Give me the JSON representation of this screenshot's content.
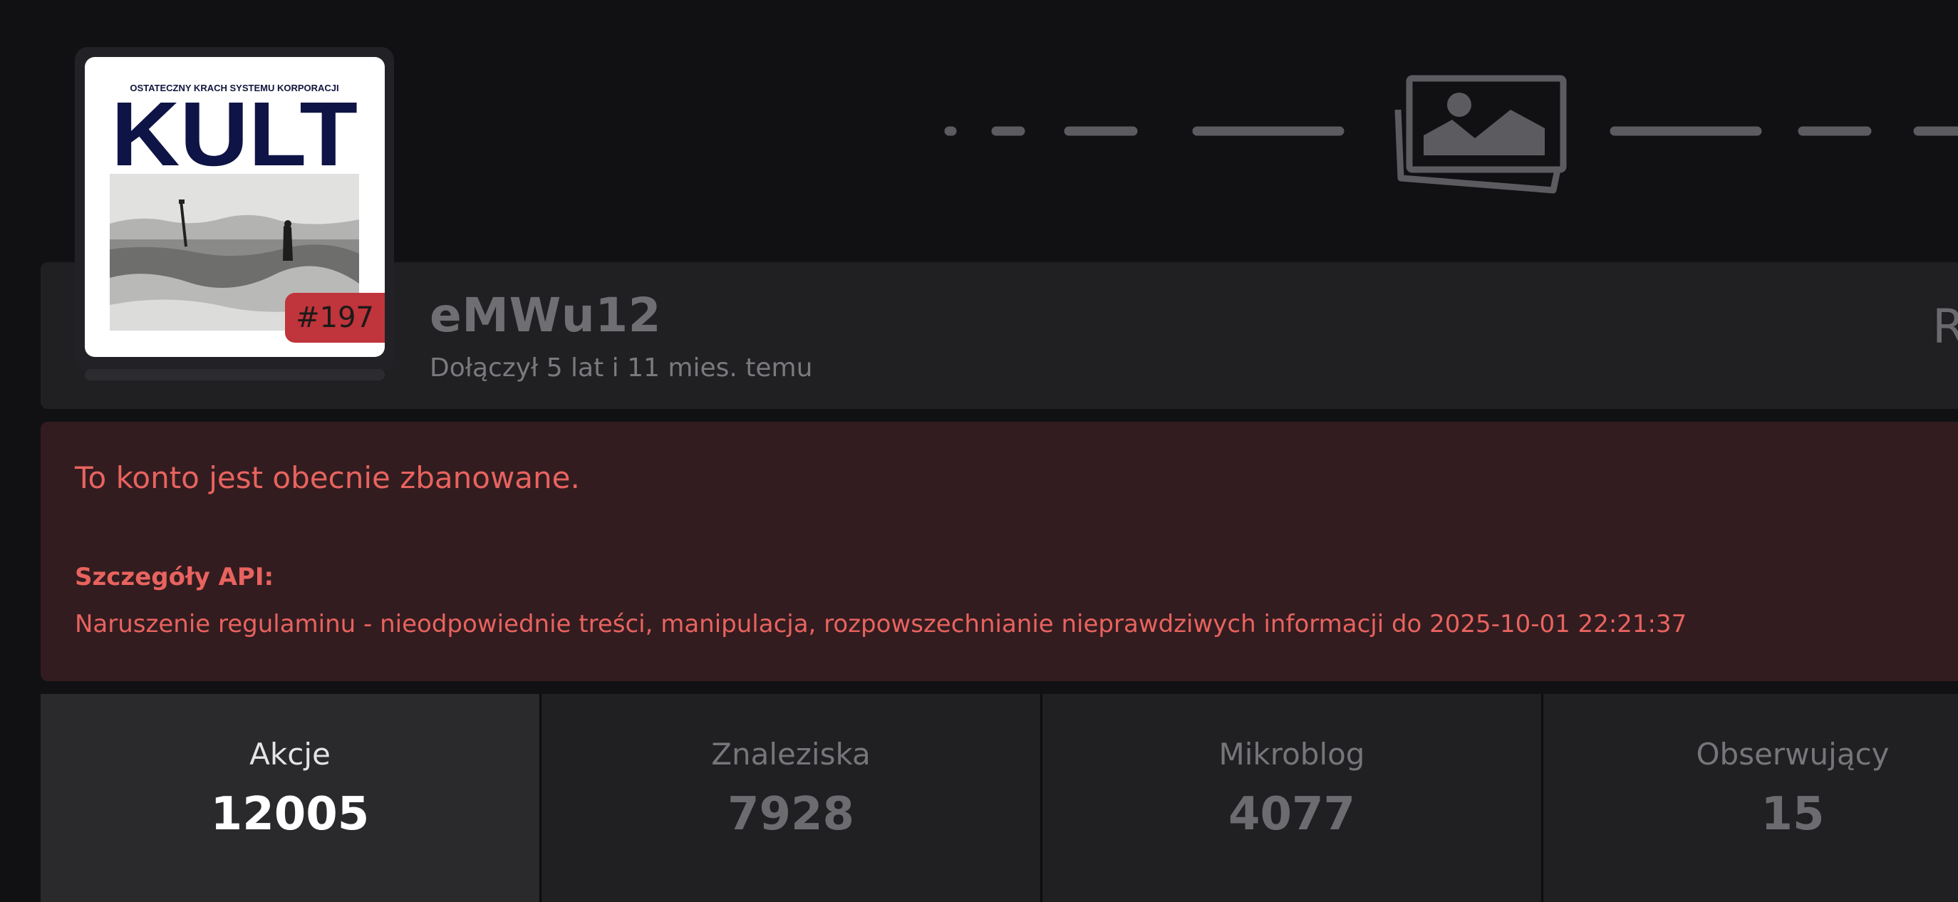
{
  "profile": {
    "username": "eMWu12",
    "joined": "Dołączył 5 lat i 11 mies. temu",
    "rank_badge": "#197",
    "avatar": {
      "banner_text": "OSTATECZNY KRACH SYSTEMU KORPORACJI",
      "title_text": "KULT"
    },
    "right_edge_text": "R"
  },
  "cover": {
    "icon": "image-placeholder-icon"
  },
  "ban_notice": {
    "title": "To konto jest obecnie zbanowane.",
    "api_label": "Szczegóły API:",
    "api_detail": "Naruszenie regulaminu - nieodpowiednie treści, manipulacja, rozpowszechnianie nieprawdziwych informacji do 2025-10-01 22:21:37"
  },
  "stats": [
    {
      "label": "Akcje",
      "value": "12005",
      "active": true
    },
    {
      "label": "Znaleziska",
      "value": "7928",
      "active": false
    },
    {
      "label": "Mikroblog",
      "value": "4077",
      "active": false
    },
    {
      "label": "Obserwujący",
      "value": "15",
      "active": false
    }
  ],
  "colors": {
    "page_background": "#111114",
    "panel_background": "#202023",
    "ban_background": "#331c1f",
    "ban_text": "#e8635f",
    "badge_red": "#c0343b"
  }
}
